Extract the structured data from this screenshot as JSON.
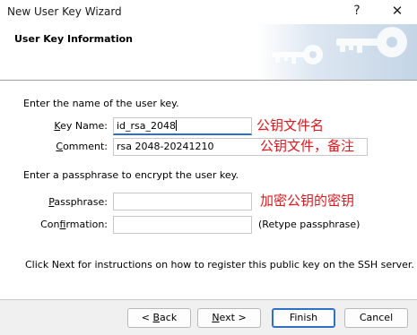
{
  "window": {
    "title": "New User Key Wizard",
    "help_glyph": "?",
    "close_glyph": "✕"
  },
  "header": {
    "title": "User Key Information",
    "art_icon": "key-icon"
  },
  "form": {
    "intro": "Enter the name of the user key.",
    "key_name": {
      "label_mnemonic": "K",
      "label_rest": "ey Name:",
      "value": "id_rsa_2048"
    },
    "comment": {
      "label_mnemonic": "C",
      "label_rest": "omment:",
      "value": "rsa 2048-20241210"
    },
    "passphrase_intro": "Enter a passphrase to encrypt the user key.",
    "passphrase": {
      "label_mnemonic": "P",
      "label_rest": "assphrase:",
      "value": ""
    },
    "confirmation": {
      "label_pre": "Con",
      "label_mnemonic": "f",
      "label_rest": "irmation:",
      "value": "",
      "hint": "(Retype passphrase)"
    },
    "footer_note": "Click Next for instructions on how to register this public key on the SSH server."
  },
  "annotations": {
    "key_name": "公钥文件名",
    "comment": "公钥文件，备注",
    "passphrase": "加密公钥的密钥",
    "color": "#e0191e"
  },
  "buttons": {
    "back": {
      "prefix": "< ",
      "mnemonic": "B",
      "rest": "ack"
    },
    "next": {
      "mnemonic": "N",
      "rest": "ext >"
    },
    "finish": "Finish",
    "cancel": "Cancel"
  }
}
